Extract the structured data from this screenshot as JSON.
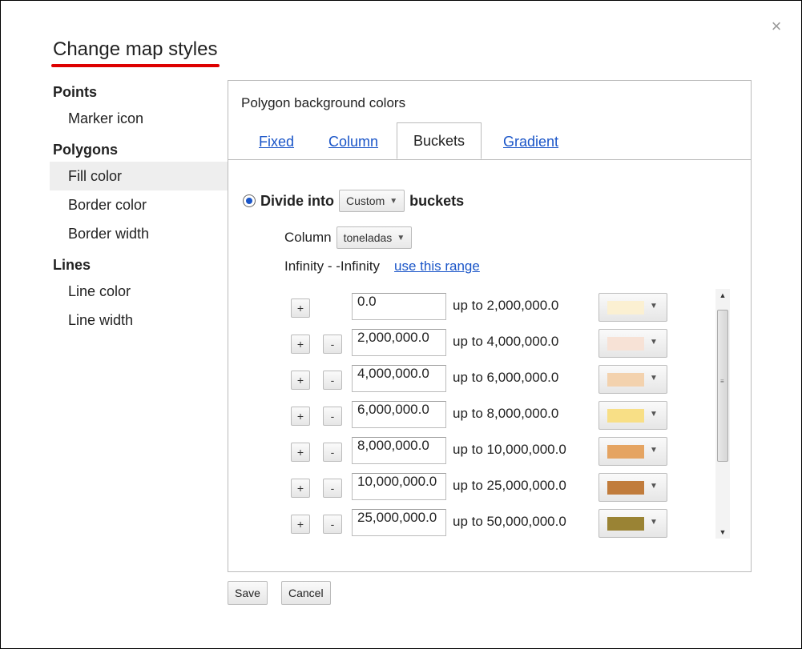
{
  "dialog": {
    "title": "Change map styles",
    "close_icon": "×"
  },
  "sidebar": {
    "points_heading": "Points",
    "marker_icon": "Marker icon",
    "polygons_heading": "Polygons",
    "fill_color": "Fill color",
    "border_color": "Border color",
    "border_width": "Border width",
    "lines_heading": "Lines",
    "line_color": "Line color",
    "line_width": "Line width",
    "active_item": "Fill color"
  },
  "panel": {
    "subtitle": "Polygon background colors",
    "tabs": [
      "Fixed",
      "Column",
      "Buckets",
      "Gradient"
    ],
    "selected_tab": "Buckets"
  },
  "buckets_form": {
    "divide_into": "Divide into",
    "bucket_mode": "Custom",
    "buckets_word": "buckets",
    "column_label": "Column",
    "column_value": "toneladas",
    "range_text": "Infinity - -Infinity",
    "use_range_link": "use this range",
    "plus_label": "+",
    "minus_label": "-",
    "rows": [
      {
        "from": "0.0",
        "upto": "up to 2,000,000.0",
        "color": "#fbf0d2",
        "has_minus": false
      },
      {
        "from": "2,000,000.0",
        "upto": "up to 4,000,000.0",
        "color": "#f7e2d6",
        "has_minus": true
      },
      {
        "from": "4,000,000.0",
        "upto": "up to 6,000,000.0",
        "color": "#f3d2ae",
        "has_minus": true
      },
      {
        "from": "6,000,000.0",
        "upto": "up to 8,000,000.0",
        "color": "#f8df86",
        "has_minus": true
      },
      {
        "from": "8,000,000.0",
        "upto": "up to 10,000,000.0",
        "color": "#e5a462",
        "has_minus": true
      },
      {
        "from": "10,000,000.0",
        "upto": "up to 25,000,000.0",
        "color": "#c17c3c",
        "has_minus": true
      },
      {
        "from": "25,000,000.0",
        "upto": "up to 50,000,000.0",
        "color": "#9a8334",
        "has_minus": true
      }
    ]
  },
  "scrollbar": {
    "up_icon": "▲",
    "down_icon": "▼",
    "grip": "≡"
  },
  "footer": {
    "save": "Save",
    "cancel": "Cancel"
  }
}
